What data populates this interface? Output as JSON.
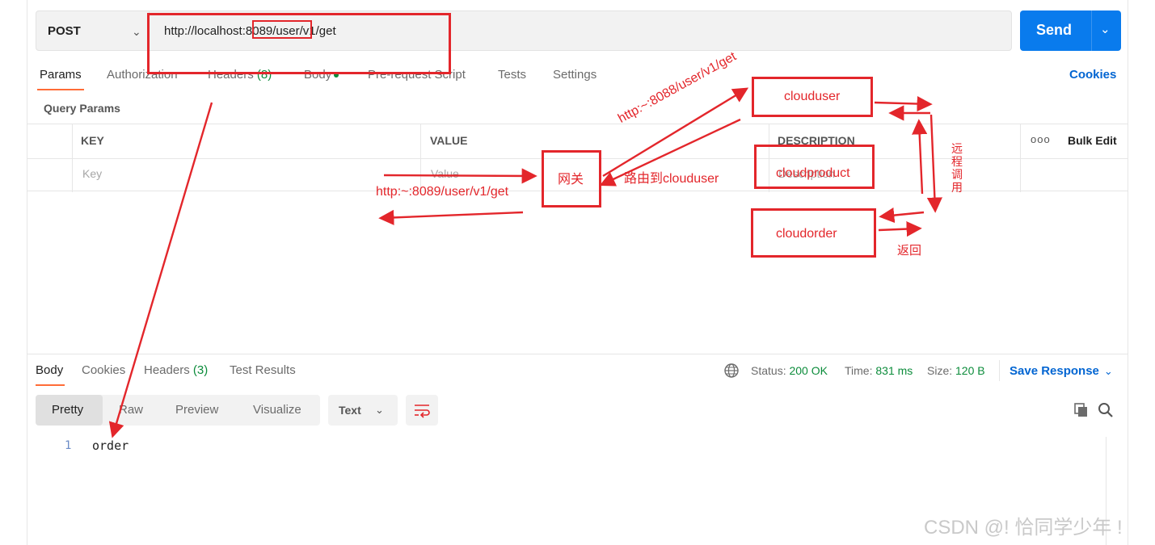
{
  "request": {
    "method": "POST",
    "url": "http://localhost:8089/user/v1/get",
    "send_label": "Send"
  },
  "request_tabs": [
    {
      "label": "Params",
      "active": true
    },
    {
      "label": "Authorization"
    },
    {
      "label": "Headers",
      "count": "(8)"
    },
    {
      "label": "Body"
    },
    {
      "label": "Pre-request Script"
    },
    {
      "label": "Tests"
    },
    {
      "label": "Settings"
    }
  ],
  "cookies_label": "Cookies",
  "query_params": {
    "title": "Query Params",
    "columns": [
      "KEY",
      "VALUE",
      "DESCRIPTION"
    ],
    "bulk_edit": "Bulk Edit",
    "more": "ooo",
    "placeholders": {
      "key": "Key",
      "value": "Value",
      "description": "Description"
    }
  },
  "response": {
    "tabs": [
      {
        "label": "Body",
        "active": true
      },
      {
        "label": "Cookies"
      },
      {
        "label": "Headers",
        "count": "(3)"
      },
      {
        "label": "Test Results"
      }
    ],
    "status_label": "Status:",
    "status_value": "200 OK",
    "time_label": "Time:",
    "time_value": "831 ms",
    "size_label": "Size:",
    "size_value": "120 B",
    "save_response": "Save Response",
    "view_modes": [
      {
        "label": "Pretty",
        "active": true
      },
      {
        "label": "Raw"
      },
      {
        "label": "Preview"
      },
      {
        "label": "Visualize"
      }
    ],
    "format": "Text",
    "body_lines": [
      {
        "no": "1",
        "text": "order"
      }
    ]
  },
  "annotations": {
    "gateway": "网关",
    "clouduser": "clouduser",
    "cloudproduct": "cloudproduct",
    "cloudorder": "cloudorder",
    "to_gateway_url": "http:~:8089/user/v1/get",
    "to_user_url": "http:~:8088/user/v1/get",
    "route_label": "路由到clouduser",
    "rpc_label": "远程调用",
    "return_label": "返回"
  },
  "colors": {
    "accent": "#ff6c37",
    "send": "#097bed",
    "link": "#0265d2",
    "status_ok": "#0c8c3b",
    "annotation": "#e3262b"
  },
  "icons": [
    "chevron-down-icon",
    "globe-icon",
    "wrap-lines-icon",
    "copy-icon",
    "search-icon"
  ],
  "watermark": "CSDN @! 恰同学少年 !"
}
